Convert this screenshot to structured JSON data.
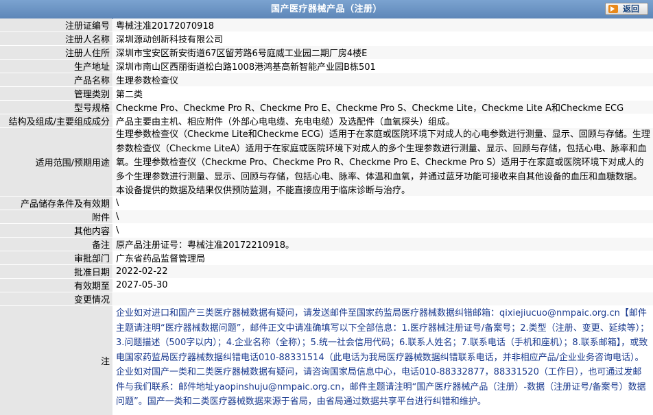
{
  "header": {
    "title": "国产医疗器械产品（注册）",
    "back_label": "返回"
  },
  "fields": [
    {
      "label": "注册证编号",
      "value": "粤械注准20172070918"
    },
    {
      "label": "注册人名称",
      "value": "深圳源动创新科技有限公司"
    },
    {
      "label": "注册人住所",
      "value": "深圳市宝安区新安街道67区留芳路6号庭威工业园二期厂房4楼E"
    },
    {
      "label": "生产地址",
      "value": "深圳市南山区西丽街道松白路1008港鸿基高新智能产业园B栋501"
    },
    {
      "label": "产品名称",
      "value": "生理参数检查仪"
    },
    {
      "label": "管理类别",
      "value": "第二类"
    },
    {
      "label": "型号规格",
      "value": "Checkme Pro、Checkme Pro R、Checkme Pro E、Checkme Pro S、Checkme Lite，Checkme Lite A和Checkme ECG"
    },
    {
      "label": "结构及组成/主要组成成分",
      "value": "产品主要由主机、相应附件（外部心电电缆、充电电缆）及选配件（血氧探头）组成。"
    },
    {
      "label": "适用范围/预期用途",
      "value": "生理参数检查仪（Checkme Lite和Checkme ECG）适用于在家庭或医院环境下对成人的心电参数进行测量、显示、回顾与存储。生理参数检查仪（Checkme LiteA）适用于在家庭或医院环境下对成人的多个生理参数进行测量、显示、回顾与存储，包括心电、脉率和血氧。生理参数检查仪（Checkme Pro、Checkme Pro R、Checkme Pro E、Checkme Pro S）适用于在家庭或医院环境下对成人的多个生理参数进行测量、显示、回顾与存储，包括心电、脉率、体温和血氧，并通过蓝牙功能可接收来自其他设备的血压和血糖数据。本设备提供的数据及结果仅供预防监测，不能直接应用于临床诊断与治疗。"
    },
    {
      "label": "产品储存条件及有效期",
      "value": "\\"
    },
    {
      "label": "附件",
      "value": "\\"
    },
    {
      "label": "其他内容",
      "value": "\\"
    },
    {
      "label": "备注",
      "value": "原产品注册证号：粤械注准20172210918。"
    },
    {
      "label": "审批部门",
      "value": "广东省药品监督管理局"
    },
    {
      "label": "批准日期",
      "value": "2022-02-22"
    },
    {
      "label": "有效期至",
      "value": "2027-05-30"
    },
    {
      "label": "变更情况",
      "value": ""
    },
    {
      "label": "注",
      "value": "企业如对进口和国产三类医疗器械数据有疑问，请发送邮件至国家药监局医疗器械数据纠错邮箱：qixiejiucuo@nmpaic.org.cn【邮件主题请注明“医疗器械数据问题”，邮件正文中请准确填写以下全部信息：1.医疗器械注册证号/备案号；2.类型（注册、变更、延续等）；3.问题描述（500字以内）；4.企业名称（全称）；5.统一社会信用代码；6.联系人姓名；7.联系电话（手机和座机）；8.联系邮箱】，或致电国家药监局医疗器械数据纠错电话010-88331514（此电话为我局医疗器械数据纠错联系电话，并非相应产品/企业业务咨询电话）。企业如对国产一类和二类医疗器械数据有疑问，请咨询国家局信息中心，电话010-88332877，88331520（工作日），也可通过发邮件与我们联系：邮件地址yaopinshuju@nmpaic.org.cn，邮件主题请注明“国产医疗器械产品（注册）-数据（注册证号/备案号）数据问题”。国产一类和二类医疗器械数据来源于省局，由省局通过数据共享平台进行纠错和维护。"
    }
  ]
}
